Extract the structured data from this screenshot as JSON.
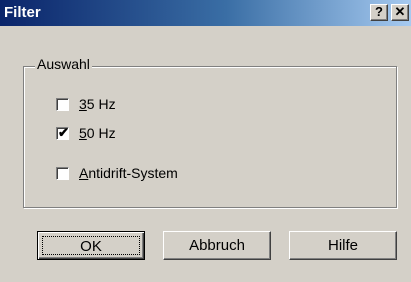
{
  "window": {
    "title": "Filter",
    "help_button": "?",
    "close_button": "✕"
  },
  "group": {
    "label": "Auswahl",
    "options": [
      {
        "mnemonic": "3",
        "rest": "5 Hz",
        "checked": false
      },
      {
        "mnemonic": "5",
        "rest": "0 Hz",
        "checked": true
      },
      {
        "mnemonic": "A",
        "rest": "ntidrift-System",
        "checked": false
      }
    ]
  },
  "buttons": {
    "ok": "OK",
    "cancel": "Abbruch",
    "help": "Hilfe"
  },
  "check_mark": "✔",
  "colors": {
    "dialog_face": "#d4d0c8",
    "title_start": "#0a246a",
    "title_end": "#a6caf0"
  }
}
